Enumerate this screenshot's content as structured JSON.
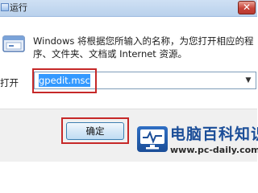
{
  "window": {
    "title": "运行",
    "close_symbol": "✕"
  },
  "dialog": {
    "description": "Windows 将根据您所输入的名称，为您打开相应的程序、文件夹、文档或 Internet 资源。",
    "open_label": "打开",
    "input_value": "gpedit.msc",
    "ok_label": "确定"
  },
  "watermark": {
    "title": "电脑百科知识",
    "url": "www.pc-daily.com"
  },
  "icons": {
    "title_icon": "run-icon",
    "run_icon": "run-program-icon",
    "dropdown": "chevron-down-icon",
    "watermark_logo": "monitor-logo-icon"
  },
  "colors": {
    "highlight_red": "#c62828",
    "selection_blue": "#3399ff",
    "watermark_blue": "#1b4e98"
  }
}
